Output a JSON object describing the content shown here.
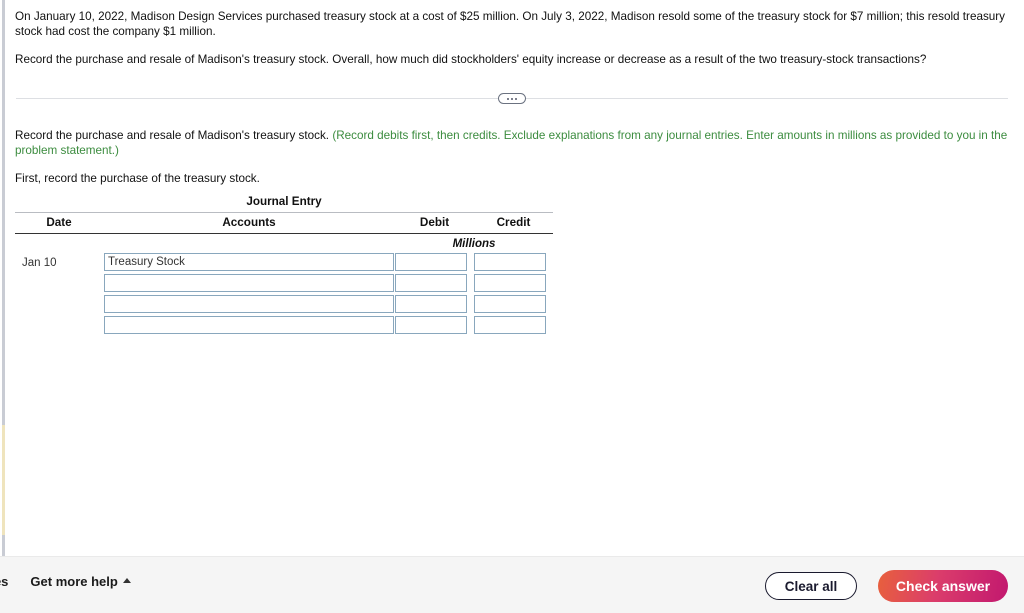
{
  "problem": {
    "statement": "On January 10, 2022, Madison Design Services purchased treasury stock at a cost of $25 million. On July 3, 2022, Madison resold some of the treasury stock for $7 million; this resold treasury stock had cost the company $1 million.",
    "question": "Record the purchase and resale of Madison's treasury stock. Overall, how much did stockholders' equity increase or decrease as a result of the two treasury-stock transactions?"
  },
  "divider": {
    "toggle_dots": "..."
  },
  "requirement": {
    "lead": "Record the purchase and resale of Madison's treasury stock. ",
    "hint": "(Record debits first, then credits. Exclude explanations from any journal entries. Enter amounts in millions as provided to you in the problem statement.)",
    "hint_color": "#3c8c3f",
    "step_prompt": "First, record the purchase of the treasury stock."
  },
  "journal": {
    "title": "Journal Entry",
    "columns": {
      "date": "Date",
      "accounts": "Accounts",
      "debit": "Debit",
      "credit": "Credit"
    },
    "units_label": "Millions",
    "date_value": "Jan 10",
    "rows": [
      {
        "account": "Treasury Stock",
        "debit": "",
        "credit": ""
      },
      {
        "account": "",
        "debit": "",
        "credit": ""
      },
      {
        "account": "",
        "debit": "",
        "credit": ""
      },
      {
        "account": "",
        "debit": "",
        "credit": ""
      }
    ]
  },
  "footer": {
    "clipped_label": "ges",
    "get_more_help": "Get more help",
    "clear_all": "Clear all",
    "check_answer": "Check answer",
    "check_answer_gradient_from": "#e8603c",
    "check_answer_gradient_to": "#c2186f"
  }
}
